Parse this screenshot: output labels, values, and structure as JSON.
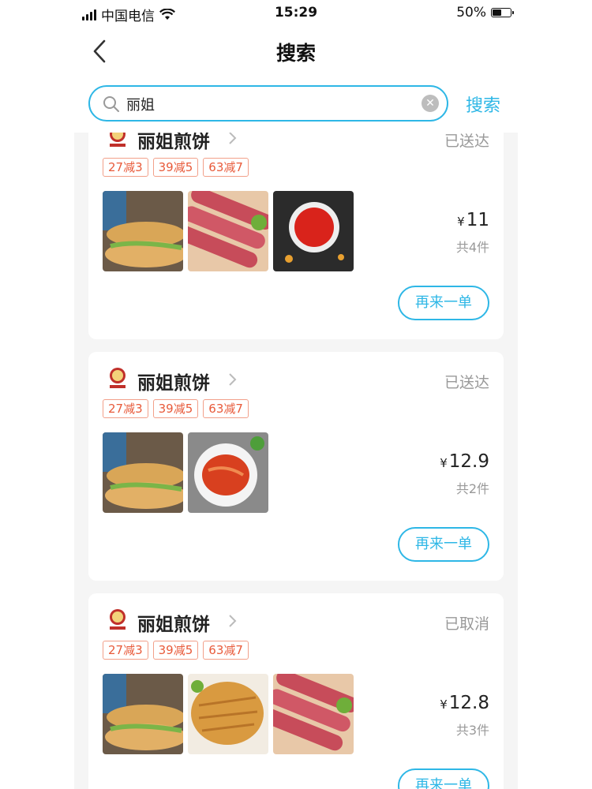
{
  "status_bar": {
    "carrier": "中国电信",
    "time": "15:29",
    "battery": "50%"
  },
  "header": {
    "title": "搜索"
  },
  "search": {
    "value": "丽姐",
    "button_label": "搜索"
  },
  "orders": [
    {
      "shop_name": "丽姐煎饼",
      "status": "已送达",
      "tags": [
        "27减3",
        "39减5",
        "63减7"
      ],
      "thumbnails": [
        "jianbing-roll",
        "sausages",
        "ketchup-dip"
      ],
      "currency": "¥",
      "price": "11",
      "count": "共4件",
      "reorder_label": "再来一单"
    },
    {
      "shop_name": "丽姐煎饼",
      "status": "已送达",
      "tags": [
        "27减3",
        "39减5",
        "63减7"
      ],
      "thumbnails": [
        "jianbing-roll",
        "kimchi"
      ],
      "currency": "¥",
      "price": "12.9",
      "count": "共2件",
      "reorder_label": "再来一单"
    },
    {
      "shop_name": "丽姐煎饼",
      "status": "已取消",
      "tags": [
        "27减3",
        "39减5",
        "63减7"
      ],
      "thumbnails": [
        "jianbing-roll",
        "fried-chicken-cutlet",
        "sausages"
      ],
      "currency": "¥",
      "price": "12.8",
      "count": "共3件",
      "reorder_label": "再来一单"
    }
  ],
  "colors": {
    "accent": "#2eb7e6",
    "tag_text": "#e85a3a",
    "tag_border": "#f2a08a",
    "muted": "#999999"
  }
}
